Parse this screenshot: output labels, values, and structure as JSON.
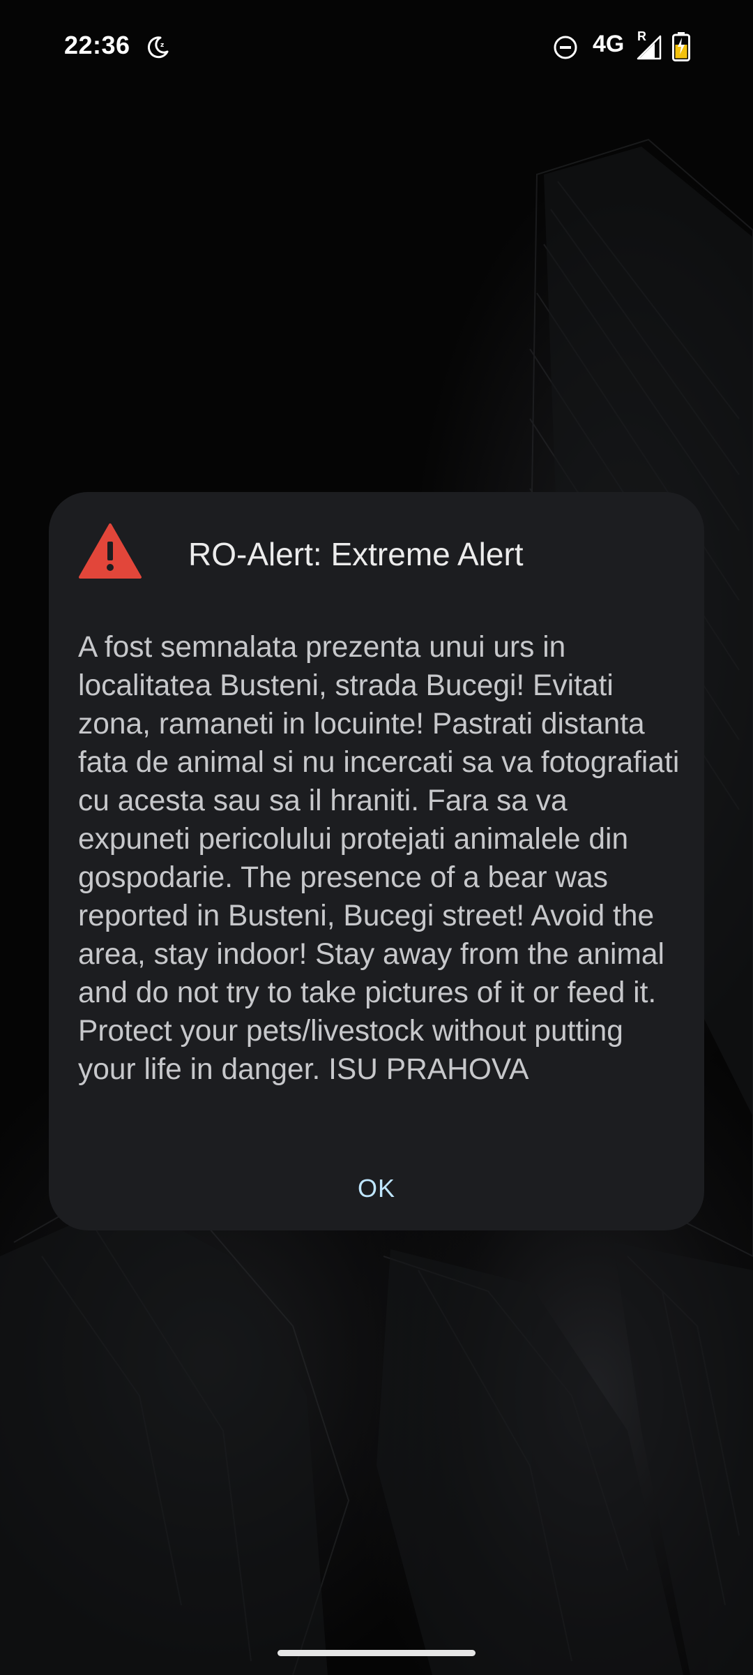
{
  "status_bar": {
    "time": "22:36",
    "network": "4G",
    "roaming": "R",
    "icons": [
      "bedtime-moon-icon",
      "do-not-disturb-icon",
      "cell-signal-icon",
      "battery-charging-icon"
    ]
  },
  "dialog": {
    "icon": "warning-triangle-icon",
    "title": "RO-Alert: Extreme Alert",
    "message": "A fost semnalata prezenta unui urs in localitatea Busteni, strada Bucegi! Evitati zona, ramaneti in locuinte! Pastrati distanta fata de animal si nu incercati sa va fotografiati cu acesta sau sa il hraniti. Fara sa va expuneti pericolului protejati animalele din gospodarie. The presence of a bear was reported in Busteni, Bucegi street! Avoid the area, stay indoor! Stay away from the animal and do not try to take pictures of it or feed it. Protect your pets/livestock without putting your life in danger. ISU PRAHOVA",
    "ok_label": "OK"
  },
  "colors": {
    "dialog_background": "#1c1d20",
    "warning": "#e2463a",
    "button_text": "#bfe6ff",
    "message_text": "#c7c8cb"
  }
}
